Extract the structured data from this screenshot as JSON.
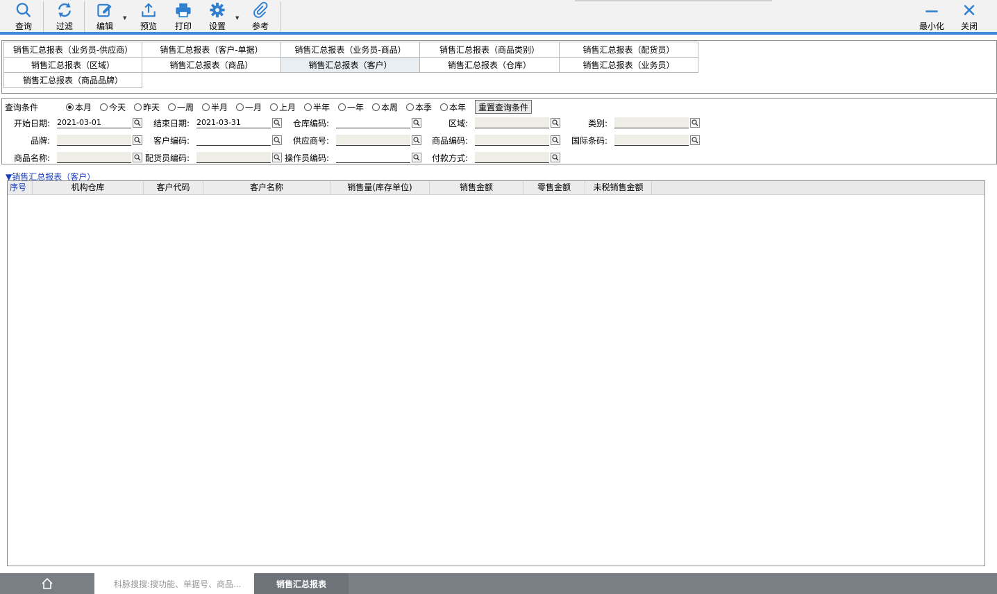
{
  "toolbar": {
    "buttons": [
      {
        "label": "查询",
        "icon": "search-icon"
      },
      {
        "label": "过滤",
        "icon": "refresh-icon"
      },
      {
        "label": "编辑",
        "icon": "edit-icon"
      },
      {
        "label": "预览",
        "icon": "upload-icon"
      },
      {
        "label": "打印",
        "icon": "print-icon"
      },
      {
        "label": "设置",
        "icon": "gear-icon"
      },
      {
        "label": "参考",
        "icon": "paperclip-icon"
      }
    ],
    "minimize_label": "最小化",
    "close_label": "关闭",
    "accent": "#3d8bdb"
  },
  "report_tabs": [
    "销售汇总报表（业务员-供应商）",
    "销售汇总报表（客户-单据）",
    "销售汇总报表（业务员-商品）",
    "销售汇总报表（商品类别）",
    "销售汇总报表（配货员）",
    "销售汇总报表（区域）",
    "销售汇总报表（商品）",
    "销售汇总报表（客户）",
    "销售汇总报表（仓库）",
    "销售汇总报表（业务员）",
    "销售汇总报表（商品品牌）"
  ],
  "active_tab": "销售汇总报表（客户）",
  "query": {
    "condition_label": "查询条件",
    "periods": [
      "本月",
      "今天",
      "昨天",
      "一周",
      "半月",
      "一月",
      "上月",
      "半年",
      "一年",
      "本周",
      "本季",
      "本年"
    ],
    "selected_period": "本月",
    "reset_label": "重置查询条件",
    "labels": {
      "start_date": "开始日期:",
      "end_date": "结束日期:",
      "warehouse_code": "仓库编码:",
      "region": "区域:",
      "category": "类别:",
      "brand": "品牌:",
      "customer_code": "客户编码:",
      "supplier_no": "供应商号:",
      "product_code": "商品编码:",
      "barcode": "国际条码:",
      "product_name": "商品名称:",
      "picker_code": "配货员编码:",
      "operator_code": "操作员编码:",
      "payment_method": "付款方式:"
    },
    "values": {
      "start_date": "2021-03-01",
      "end_date": "2021-03-31"
    }
  },
  "report": {
    "title": "▼销售汇总报表（客户）",
    "columns": [
      "序号",
      "机构仓库",
      "客户代码",
      "客户名称",
      "销售量(库存单位)",
      "销售金额",
      "零售金额",
      "未税销售金额"
    ]
  },
  "bottom": {
    "search_placeholder": "科脉搜搜:搜功能、单据号、商品...",
    "active_tab": "销售汇总报表"
  }
}
